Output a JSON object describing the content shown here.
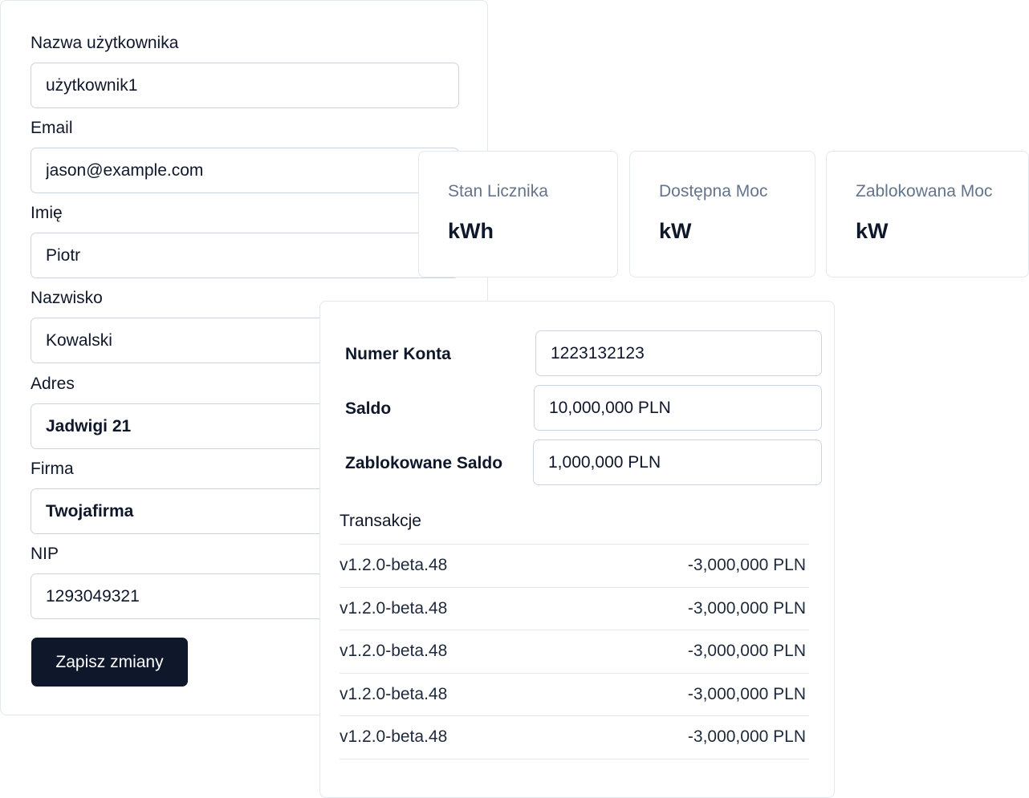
{
  "profile": {
    "fields": [
      {
        "label": "Nazwa użytkownika",
        "value": "użytkownik1"
      },
      {
        "label": "Email",
        "value": "jason@example.com"
      },
      {
        "label": "Imię",
        "value": "Piotr"
      },
      {
        "label": "Nazwisko",
        "value": "Kowalski"
      },
      {
        "label": "Adres",
        "value": "Jadwigi 21"
      },
      {
        "label": "Firma",
        "value": "Twojafirma"
      },
      {
        "label": "NIP",
        "value": "1293049321"
      }
    ],
    "save_label": "Zapisz zmiany"
  },
  "stats": [
    {
      "label": "Stan Licznika",
      "unit": "kWh"
    },
    {
      "label": "Dostępna Moc",
      "unit": "kW"
    },
    {
      "label": "Zablokowana Moc",
      "unit": "kW"
    }
  ],
  "account": {
    "number_label": "Numer Konta",
    "number_value": "1223132123",
    "balance_label": "Saldo",
    "balance_value": "10,000,000 PLN",
    "blocked_label": "Zablokowane Saldo",
    "blocked_value": "1,000,000 PLN",
    "transactions_heading": "Transakcje",
    "transactions": [
      {
        "name": "v1.2.0-beta.48",
        "amount": "-3,000,000 PLN"
      },
      {
        "name": "v1.2.0-beta.48",
        "amount": "-3,000,000 PLN"
      },
      {
        "name": "v1.2.0-beta.48",
        "amount": "-3,000,000 PLN"
      },
      {
        "name": "v1.2.0-beta.48",
        "amount": "-3,000,000 PLN"
      },
      {
        "name": "v1.2.0-beta.48",
        "amount": "-3,000,000 PLN"
      }
    ]
  }
}
